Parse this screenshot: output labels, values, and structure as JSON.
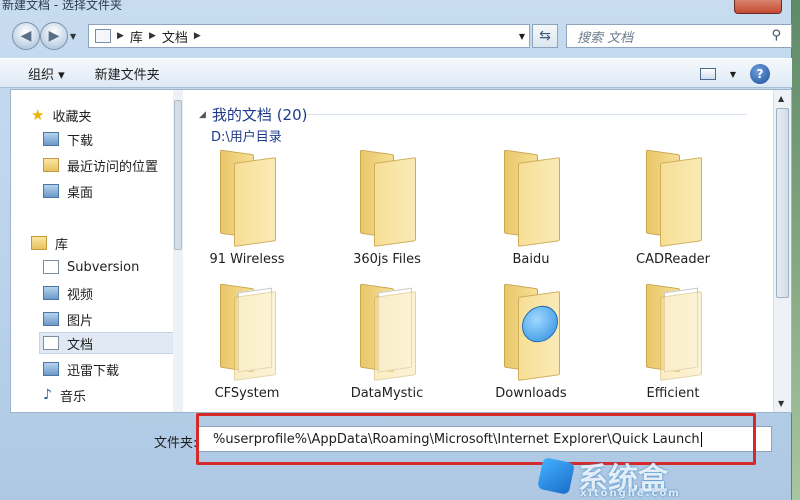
{
  "window": {
    "title": "新建文档 - 选择文件夹"
  },
  "navigation": {
    "address_crumbs": [
      "库",
      "文档"
    ],
    "search_placeholder": "搜索 文档"
  },
  "toolbar": {
    "organize_label": "组织 ▾",
    "new_folder_label": "新建文件夹"
  },
  "sidebar": {
    "favorites": "收藏夹",
    "items_fav": [
      "下载",
      "最近访问的位置",
      "桌面"
    ],
    "library": "库",
    "items_lib": [
      "Subversion",
      "视频",
      "图片",
      "文档",
      "迅雷下载",
      "音乐"
    ]
  },
  "content": {
    "group_title": "我的文档 (20)",
    "group_path": "D:\\用户目录",
    "folders": [
      "91 Wireless",
      "360js Files",
      "Baidu",
      "CADReader",
      "CFSystem",
      "DataMystic",
      "Downloads",
      "Efficient"
    ]
  },
  "footer": {
    "filename_label": "文件夹:",
    "filename_value": "%userprofile%\\AppData\\Roaming\\Microsoft\\Internet Explorer\\Quick Launch"
  },
  "watermark": {
    "text": "系统盒",
    "sub": "xitonghe.com"
  }
}
